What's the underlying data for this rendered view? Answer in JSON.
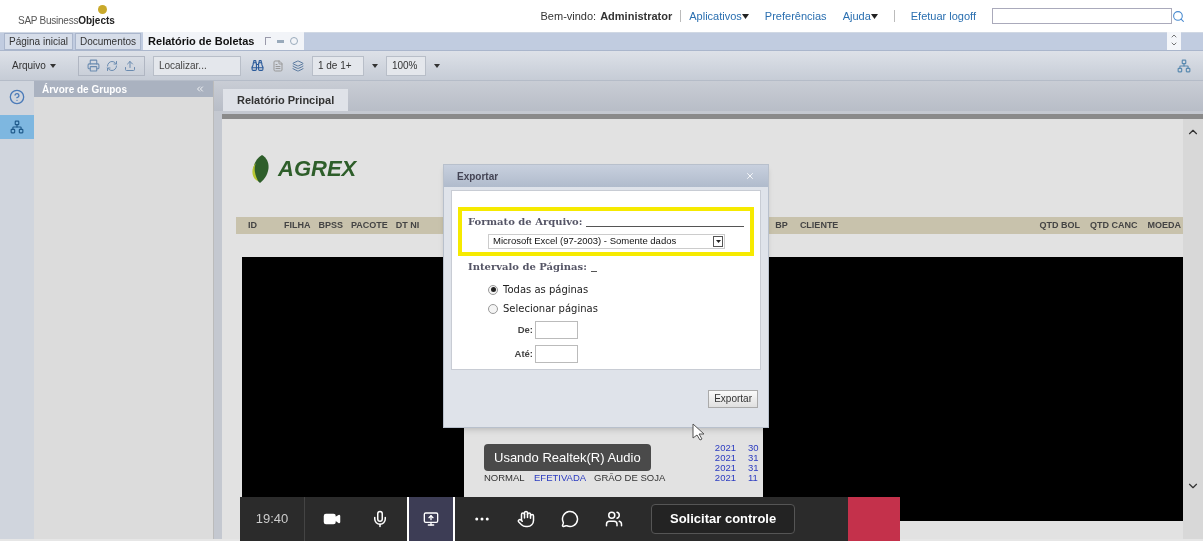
{
  "header": {
    "logo_light": "SAP Business",
    "logo_bold": "Objects",
    "welcome_label": "Bem-vindo:",
    "user": "Administrator",
    "links": [
      {
        "label": "Aplicativos",
        "dropdown": true
      },
      {
        "label": "Preferências",
        "dropdown": false
      },
      {
        "label": "Ajuda",
        "dropdown": true
      },
      {
        "label": "Efetuar logoff",
        "dropdown": false
      }
    ]
  },
  "tabs": [
    {
      "label": "Página inicial",
      "selected": false
    },
    {
      "label": "Documentos",
      "selected": false
    },
    {
      "label": "Relatório de Boletas",
      "selected": true
    }
  ],
  "toolbar": {
    "file_menu": "Arquivo",
    "search": {
      "placeholder": "Localizar..."
    },
    "page": "1 de 1+",
    "zoom": "100%"
  },
  "left_panel": {
    "title": "Árvore de Grupos"
  },
  "report": {
    "tab": "Relatório Principal",
    "logo": "AGREX",
    "columns_left": [
      "ID",
      "FILHA",
      "BPSS",
      "PACOTE",
      "DT NI"
    ],
    "columns_right": [
      "BP",
      "CLIENTE"
    ],
    "columns_far_right": [
      "QTD BOL",
      "QTD CANC",
      "MOEDA"
    ],
    "rows": [
      {
        "year": "2021",
        "column_5": "30"
      },
      {
        "year": "2021",
        "column_5": "31"
      },
      {
        "year": "2021",
        "column_5": "31"
      },
      {
        "status": "NORMAL",
        "state": "EFETIVADA",
        "product": "GRÃO DE SOJA",
        "year": "2021",
        "column_5": "11"
      }
    ]
  },
  "dialog": {
    "title": "Exportar",
    "format_label": "Formato de Arquivo:",
    "format_value": "Microsoft Excel (97-2003) - Somente dados",
    "highlighted": true,
    "range_label": "Intervalo de Páginas:",
    "options": [
      {
        "label": "Todas as páginas",
        "selected": true
      },
      {
        "label": "Selecionar páginas",
        "selected": false
      }
    ],
    "from_label": "De:",
    "to_label": "Até:",
    "button": "Exportar"
  },
  "call_bar": {
    "time": "19:40",
    "share_active": true,
    "control_button": "Solicitar controle",
    "tooltip": "Usando Realtek(R) Audio"
  }
}
